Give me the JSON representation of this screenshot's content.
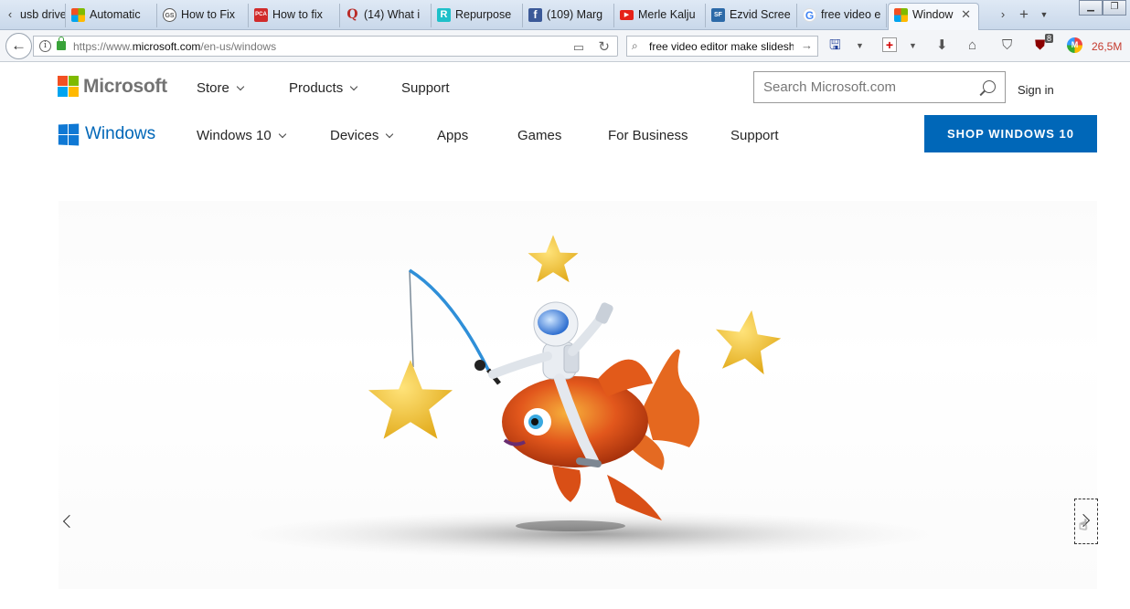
{
  "browser": {
    "tabs": [
      {
        "label": "usb drive",
        "icon": "windows-flag-icon",
        "color": "#4a8ad4"
      },
      {
        "label": "Automatic",
        "icon": "microsoft-icon",
        "color": "#f25022"
      },
      {
        "label": "How to Fix",
        "icon": "gear-site-icon",
        "color": "#555555"
      },
      {
        "label": "How to fix",
        "icon": "pca-icon",
        "color": "#d12b2b"
      },
      {
        "label": "(14) What i",
        "icon": "quora-icon",
        "color": "#b92b27"
      },
      {
        "label": "Repurpose",
        "icon": "repurpose-icon",
        "color": "#1ec0c9"
      },
      {
        "label": "(109) Marg",
        "icon": "facebook-icon",
        "color": "#3b5998"
      },
      {
        "label": "Merle Kalju",
        "icon": "youtube-icon",
        "color": "#e62117"
      },
      {
        "label": "Ezvid Scree",
        "icon": "sf-icon",
        "color": "#2c6aa8"
      },
      {
        "label": "free video e",
        "icon": "google-icon",
        "color": "#4285f4"
      },
      {
        "label": "Window",
        "icon": "microsoft-icon",
        "color": "#f25022",
        "active": true
      }
    ],
    "url_prefix": "https://www.",
    "url_domain": "microsoft.com",
    "url_path": "/en-us/windows",
    "search_query": "free video editor make slideshow",
    "ublock_badge": "8",
    "memory_text": "26,5M"
  },
  "header": {
    "brand": "Microsoft",
    "nav": [
      {
        "label": "Store",
        "has_menu": true
      },
      {
        "label": "Products",
        "has_menu": true
      },
      {
        "label": "Support",
        "has_menu": false
      }
    ],
    "search_placeholder": "Search Microsoft.com",
    "signin": "Sign in"
  },
  "windows_nav": {
    "brand": "Windows",
    "items": [
      {
        "label": "Windows 10",
        "has_menu": true
      },
      {
        "label": "Devices",
        "has_menu": true
      },
      {
        "label": "Apps",
        "has_menu": false
      },
      {
        "label": "Games",
        "has_menu": false
      },
      {
        "label": "For Business",
        "has_menu": false
      },
      {
        "label": "Support",
        "has_menu": false
      }
    ],
    "cta": "SHOP WINDOWS 10"
  },
  "colors": {
    "ms_red": "#f25022",
    "ms_green": "#7fba00",
    "ms_blue": "#00a4ef",
    "ms_yellow": "#ffb900",
    "windows_blue": "#0067b8",
    "star": "#f0c531",
    "fish": "#e2571c"
  }
}
